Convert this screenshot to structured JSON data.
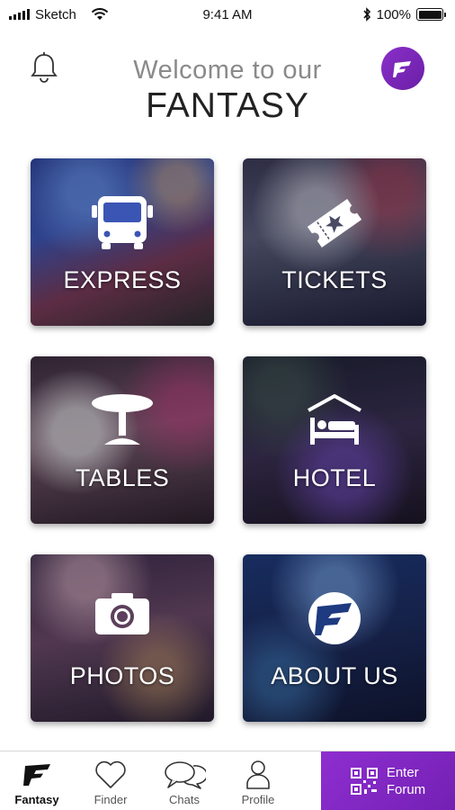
{
  "status_bar": {
    "carrier": "Sketch",
    "time": "9:41 AM",
    "battery": "100%"
  },
  "header": {
    "welcome": "Welcome to our",
    "brand": "FANTASY"
  },
  "tiles": [
    {
      "label": "EXPRESS",
      "icon": "bus-icon"
    },
    {
      "label": "TICKETS",
      "icon": "ticket-icon"
    },
    {
      "label": "TABLES",
      "icon": "table-icon"
    },
    {
      "label": "HOTEL",
      "icon": "hotel-bed-icon"
    },
    {
      "label": "PHOTOS",
      "icon": "camera-icon"
    },
    {
      "label": "ABOUT US",
      "icon": "fantasy-logo-icon"
    }
  ],
  "bottom_nav": {
    "items": [
      {
        "label": "Fantasy",
        "icon": "fantasy-logo-icon",
        "active": true
      },
      {
        "label": "Finder",
        "icon": "heart-icon"
      },
      {
        "label": "Chats",
        "icon": "chat-bubbles-icon"
      },
      {
        "label": "Profile",
        "icon": "user-icon"
      }
    ],
    "enter_forum": {
      "line1": "Enter",
      "line2": "Forum",
      "icon": "qr-code-icon"
    }
  },
  "colors": {
    "accent": "#7b25bd",
    "text_dark": "#222222",
    "text_muted": "#8a8a8a"
  }
}
